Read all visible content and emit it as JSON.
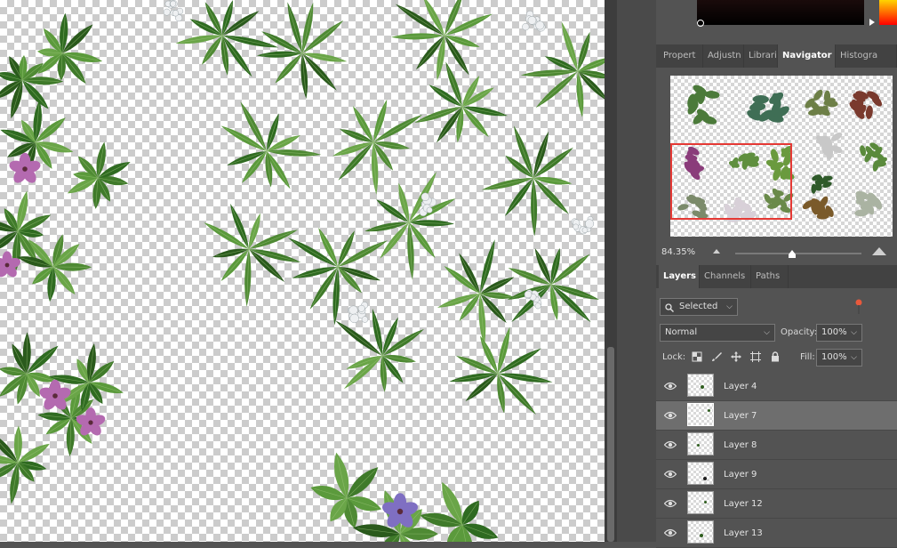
{
  "canvas": {
    "content": "transparent-checkerboard-with-plants"
  },
  "panels": {
    "top_tabs": [
      {
        "label": "Propert",
        "active": false
      },
      {
        "label": "Adjustn",
        "active": false
      },
      {
        "label": "Librarie",
        "active": false
      },
      {
        "label": "Navigator",
        "active": true
      },
      {
        "label": "Histogra",
        "active": false
      }
    ],
    "layer_tabs": [
      {
        "label": "Layers",
        "active": true
      },
      {
        "label": "Channels",
        "active": false
      },
      {
        "label": "Paths",
        "active": false
      }
    ]
  },
  "navigator": {
    "zoom": "84.35%",
    "zoom_slider_fraction": 0.45,
    "viewbox_color": "#e53935"
  },
  "layers_panel": {
    "filter_value": "Selected",
    "blend_mode": "Normal",
    "opacity_label": "Opacity:",
    "opacity_value": "100%",
    "lock_label": "Lock:",
    "fill_label": "Fill:",
    "fill_value": "100%",
    "filter_toggle_color": "#e8593c",
    "lock_icons": [
      "lock-transparent-pixels-icon",
      "lock-image-pixels-icon",
      "lock-position-icon",
      "lock-artboard-icon",
      "lock-all-icon"
    ],
    "layers": [
      {
        "name": "Layer 4",
        "visible": true,
        "selected": false
      },
      {
        "name": "Layer 7",
        "visible": true,
        "selected": true
      },
      {
        "name": "Layer 8",
        "visible": true,
        "selected": false
      },
      {
        "name": "Layer 9",
        "visible": true,
        "selected": false
      },
      {
        "name": "Layer 12",
        "visible": true,
        "selected": false
      },
      {
        "name": "Layer 13",
        "visible": true,
        "selected": false
      }
    ]
  },
  "colors": {
    "panel_bg": "#535353",
    "tab_bar_bg": "#424242",
    "selected_row_bg": "#6e6e6e",
    "leaf_green": "#3f7a2a",
    "flower_pink": "#b46ab0",
    "flower_purple": "#7f6fc2"
  }
}
